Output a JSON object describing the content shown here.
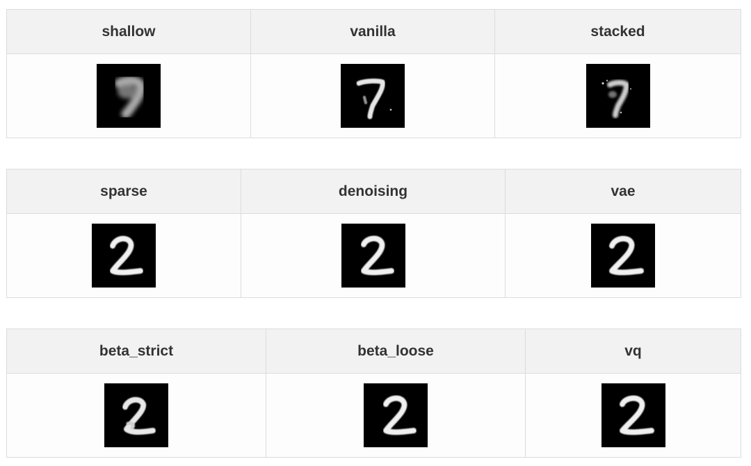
{
  "tables": [
    {
      "headers": [
        "shallow",
        "vanilla",
        "stacked"
      ],
      "images": [
        {
          "icon": "blurry-digit-7-image",
          "digit": "7",
          "quality": "blurry"
        },
        {
          "icon": "digit-7-image",
          "digit": "7",
          "quality": "clear"
        },
        {
          "icon": "noisy-digit-7-image",
          "digit": "7",
          "quality": "noisy"
        }
      ]
    },
    {
      "headers": [
        "sparse",
        "denoising",
        "vae"
      ],
      "images": [
        {
          "icon": "digit-2-image",
          "digit": "2",
          "quality": "clear"
        },
        {
          "icon": "digit-2-image",
          "digit": "2",
          "quality": "clear"
        },
        {
          "icon": "digit-2-image",
          "digit": "2",
          "quality": "clear"
        }
      ]
    },
    {
      "headers": [
        "beta_strict",
        "beta_loose",
        "vq"
      ],
      "images": [
        {
          "icon": "digit-2-image",
          "digit": "2",
          "quality": "clear"
        },
        {
          "icon": "digit-2-image",
          "digit": "2",
          "quality": "clear"
        },
        {
          "icon": "digit-2-image",
          "digit": "2",
          "quality": "clear"
        }
      ]
    }
  ],
  "colors": {
    "header_bg": "#f2f2f2",
    "cell_bg": "#fdfdfd",
    "border": "#dcdcdc",
    "header_text": "#333333",
    "image_bg": "#000000",
    "stroke": "#f0f0f0"
  }
}
